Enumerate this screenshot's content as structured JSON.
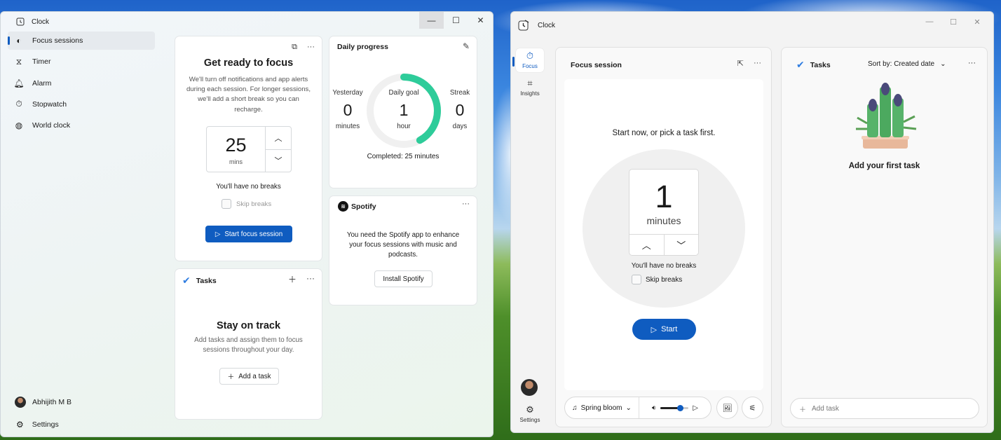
{
  "window1": {
    "app_title": "Clock",
    "controls": {
      "minimize": "—",
      "maximize": "☐",
      "close": "✕"
    },
    "nav": [
      {
        "label": "Focus sessions",
        "icon": "focus-icon",
        "selected": true
      },
      {
        "label": "Timer",
        "icon": "hourglass-icon"
      },
      {
        "label": "Alarm",
        "icon": "bell-icon"
      },
      {
        "label": "Stopwatch",
        "icon": "stopwatch-icon"
      },
      {
        "label": "World clock",
        "icon": "globe-icon"
      }
    ],
    "user": "Abhijith M B",
    "settings_label": "Settings",
    "focus_card": {
      "title": "Get ready to focus",
      "description": "We'll turn off notifications and app alerts during each session. For longer sessions, we'll add a short break so you can recharge.",
      "minutes": "25",
      "unit": "mins",
      "no_breaks": "You'll have no breaks",
      "skip_breaks": "Skip breaks",
      "start_button": "Start focus session"
    },
    "daily_progress": {
      "title": "Daily progress",
      "yesterday": {
        "label": "Yesterday",
        "value": "0",
        "unit": "minutes"
      },
      "goal": {
        "label": "Daily goal",
        "value": "1",
        "unit": "hour"
      },
      "streak": {
        "label": "Streak",
        "value": "0",
        "unit": "days"
      },
      "completed": "Completed: 25 minutes",
      "progress_fraction": 0.42,
      "ring_color": "#2ecc9a"
    },
    "spotify": {
      "brand": "Spotify",
      "message": "You need the Spotify app to enhance your focus sessions with music and podcasts.",
      "install_button": "Install Spotify"
    },
    "tasks_card": {
      "title": "Tasks",
      "heading": "Stay on track",
      "description": "Add tasks and assign them to focus sessions throughout your day.",
      "add_button": "Add a task"
    }
  },
  "window2": {
    "app_title": "Clock",
    "rail": [
      {
        "label": "Focus",
        "icon": "focus-timer-icon",
        "selected": true
      },
      {
        "label": "Insights",
        "icon": "insights-icon"
      }
    ],
    "settings_label": "Settings",
    "focus_session": {
      "title": "Focus session",
      "prompt": "Start now, or pick a task first.",
      "minutes": "1",
      "unit": "minutes",
      "no_breaks": "You'll have no breaks",
      "skip_breaks": "Skip breaks",
      "start_button": "Start"
    },
    "player": {
      "track": "Spring bloom",
      "volume_fraction": 0.7
    },
    "tasks": {
      "title": "Tasks",
      "sort_label": "Sort by: Created date",
      "empty_heading": "Add your first task",
      "add_placeholder": "Add task"
    },
    "accent_color": "#0f5cc0"
  }
}
